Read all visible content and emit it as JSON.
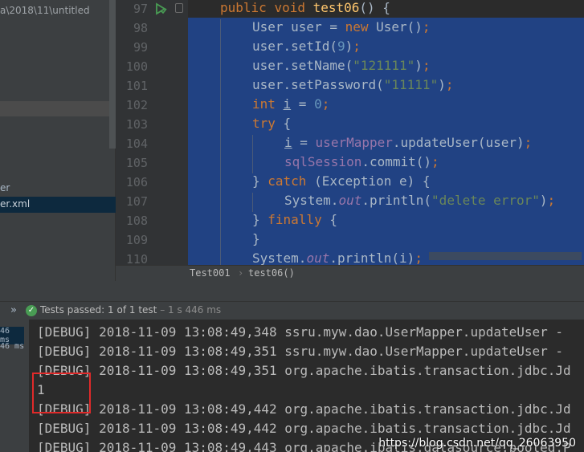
{
  "sidebar": {
    "path": "a\\2018\\11\\untitled",
    "item_partial": "er",
    "item_selected": "er.xml"
  },
  "editor": {
    "line_numbers": [
      "97",
      "98",
      "99",
      "100",
      "101",
      "102",
      "103",
      "104",
      "105",
      "106",
      "107",
      "108",
      "109",
      "110"
    ],
    "lines": [
      [
        {
          "t": "public ",
          "c": "kw"
        },
        {
          "t": "void ",
          "c": "kw"
        },
        {
          "t": "test06",
          "c": "fn"
        },
        {
          "t": "() {",
          "c": ""
        }
      ],
      [
        {
          "t": "User user = ",
          "c": ""
        },
        {
          "t": "new ",
          "c": "kw"
        },
        {
          "t": "User()",
          "c": ""
        },
        {
          "t": ";",
          "c": "kw"
        }
      ],
      [
        {
          "t": "user.setId(",
          "c": ""
        },
        {
          "t": "9",
          "c": "num"
        },
        {
          "t": ")",
          "c": ""
        },
        {
          "t": ";",
          "c": "kw"
        }
      ],
      [
        {
          "t": "user.setName(",
          "c": ""
        },
        {
          "t": "\"121111\"",
          "c": "str"
        },
        {
          "t": ")",
          "c": ""
        },
        {
          "t": ";",
          "c": "kw"
        }
      ],
      [
        {
          "t": "user.setPassword(",
          "c": ""
        },
        {
          "t": "\"11111\"",
          "c": "str"
        },
        {
          "t": ")",
          "c": ""
        },
        {
          "t": ";",
          "c": "kw"
        }
      ],
      [
        {
          "t": "int ",
          "c": "kw"
        },
        {
          "t": "i",
          "c": "und"
        },
        {
          "t": " = ",
          "c": ""
        },
        {
          "t": "0",
          "c": "num"
        },
        {
          "t": ";",
          "c": "kw"
        }
      ],
      [
        {
          "t": "try ",
          "c": "kw"
        },
        {
          "t": "{",
          "c": ""
        }
      ],
      [
        {
          "t": "i",
          "c": "und"
        },
        {
          "t": " = ",
          "c": ""
        },
        {
          "t": "userMapper",
          "c": "fld"
        },
        {
          "t": ".updateUser(user)",
          "c": ""
        },
        {
          "t": ";",
          "c": "kw"
        }
      ],
      [
        {
          "t": "sqlSession",
          "c": "fld"
        },
        {
          "t": ".commit()",
          "c": ""
        },
        {
          "t": ";",
          "c": "kw"
        }
      ],
      [
        {
          "t": "} ",
          "c": ""
        },
        {
          "t": "catch ",
          "c": "kw"
        },
        {
          "t": "(Exception e) {",
          "c": ""
        }
      ],
      [
        {
          "t": "System.",
          "c": ""
        },
        {
          "t": "out",
          "c": "sf"
        },
        {
          "t": ".println(",
          "c": ""
        },
        {
          "t": "\"delete error\"",
          "c": "str"
        },
        {
          "t": ")",
          "c": ""
        },
        {
          "t": ";",
          "c": "kw"
        }
      ],
      [
        {
          "t": "} ",
          "c": ""
        },
        {
          "t": "finally ",
          "c": "kw"
        },
        {
          "t": "{",
          "c": ""
        }
      ],
      [
        {
          "t": "}",
          "c": ""
        }
      ],
      [
        {
          "t": "System.",
          "c": ""
        },
        {
          "t": "out",
          "c": "sf"
        },
        {
          "t": ".println(i)",
          "c": ""
        },
        {
          "t": ";",
          "c": "kw"
        }
      ]
    ],
    "indents": [
      1,
      2,
      2,
      2,
      2,
      2,
      2,
      3,
      3,
      2,
      3,
      2,
      2,
      2
    ]
  },
  "breadcrumb": {
    "class": "Test001",
    "separator": "›",
    "method": "test06()"
  },
  "run": {
    "expand_icon": "»",
    "status_prefix": "Tests passed: ",
    "passed": "1",
    "of_text": " of 1 test",
    "duration": " – 1 s 446 ms",
    "left_times": [
      "46 ms",
      "46 ms"
    ]
  },
  "console": {
    "lines": [
      "[DEBUG] 2018-11-09 13:08:49,348 ssru.myw.dao.UserMapper.updateUser -",
      "[DEBUG] 2018-11-09 13:08:49,351 ssru.myw.dao.UserMapper.updateUser -",
      "[DEBUG] 2018-11-09 13:08:49,351 org.apache.ibatis.transaction.jdbc.Jd",
      "1",
      "[DEBUG] 2018-11-09 13:08:49,442 org.apache.ibatis.transaction.jdbc.Jd",
      "[DEBUG] 2018-11-09 13:08:49,442 org.apache.ibatis.transaction.jdbc.Jd",
      "[DEBUG] 2018-11-09 13:08:49,443 org.apache.ibatis.datasource.pooled.P"
    ],
    "watermark": "https://blog.csdn.net/qq_26063950"
  },
  "colors": {
    "selection": "#214283",
    "keyword": "#cc7832",
    "string": "#6a8759",
    "number": "#6897bb",
    "field": "#9876aa",
    "highlight_box": "#e02a2a",
    "pass_green": "#499c54"
  }
}
